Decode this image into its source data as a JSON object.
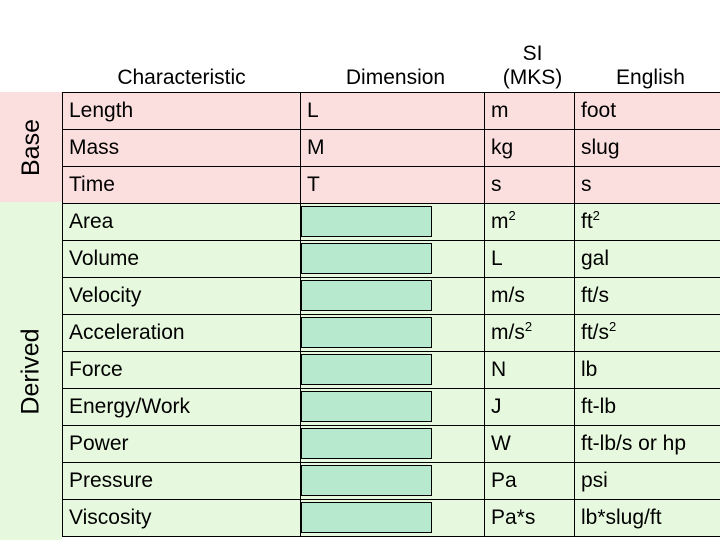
{
  "sections": [
    {
      "label": "Base"
    },
    {
      "label": "Derived"
    }
  ],
  "table": {
    "headers": {
      "characteristic": "Characteristic",
      "dimension": "Dimension",
      "si_line1": "SI",
      "si_line2": "(MKS)",
      "english": "English"
    },
    "rows": [
      {
        "group": "base",
        "characteristic": "Length",
        "dimension": "L",
        "dimension_blank": false,
        "si": "m",
        "si_sup": "",
        "english": "foot",
        "english_sup": ""
      },
      {
        "group": "base",
        "characteristic": "Mass",
        "dimension": "M",
        "dimension_blank": false,
        "si": "kg",
        "si_sup": "",
        "english": "slug",
        "english_sup": ""
      },
      {
        "group": "base",
        "characteristic": "Time",
        "dimension": "T",
        "dimension_blank": false,
        "si": "s",
        "si_sup": "",
        "english": "s",
        "english_sup": ""
      },
      {
        "group": "derived",
        "characteristic": "Area",
        "dimension": "",
        "dimension_blank": true,
        "si": "m",
        "si_sup": "2",
        "english": "ft",
        "english_sup": "2"
      },
      {
        "group": "derived",
        "characteristic": "Volume",
        "dimension": "",
        "dimension_blank": true,
        "si": "L",
        "si_sup": "",
        "english": "gal",
        "english_sup": ""
      },
      {
        "group": "derived",
        "characteristic": "Velocity",
        "dimension": "",
        "dimension_blank": true,
        "si": "m/s",
        "si_sup": "",
        "english": "ft/s",
        "english_sup": ""
      },
      {
        "group": "derived",
        "characteristic": "Acceleration",
        "dimension": "",
        "dimension_blank": true,
        "si": "m/s",
        "si_sup": "2",
        "english": "ft/s",
        "english_sup": "2"
      },
      {
        "group": "derived",
        "characteristic": "Force",
        "dimension": "",
        "dimension_blank": true,
        "si": "N",
        "si_sup": "",
        "english": "lb",
        "english_sup": ""
      },
      {
        "group": "derived",
        "characteristic": "Energy/Work",
        "dimension": "",
        "dimension_blank": true,
        "si": "J",
        "si_sup": "",
        "english": "ft-lb",
        "english_sup": ""
      },
      {
        "group": "derived",
        "characteristic": "Power",
        "dimension": "",
        "dimension_blank": true,
        "si": "W",
        "si_sup": "",
        "english": "ft-lb/s or hp",
        "english_sup": ""
      },
      {
        "group": "derived",
        "characteristic": "Pressure",
        "dimension": "",
        "dimension_blank": true,
        "si": "Pa",
        "si_sup": "",
        "english": "psi",
        "english_sup": ""
      },
      {
        "group": "derived",
        "characteristic": "Viscosity",
        "dimension": "",
        "dimension_blank": true,
        "si": "Pa*s",
        "si_sup": "",
        "english": "lb*slug/ft",
        "english_sup": ""
      }
    ]
  },
  "colors": {
    "base_fill": "#fbdede",
    "derived_fill": "#e6f8dd",
    "blank_box_fill": "#b6e9cd",
    "border": "#000000"
  }
}
